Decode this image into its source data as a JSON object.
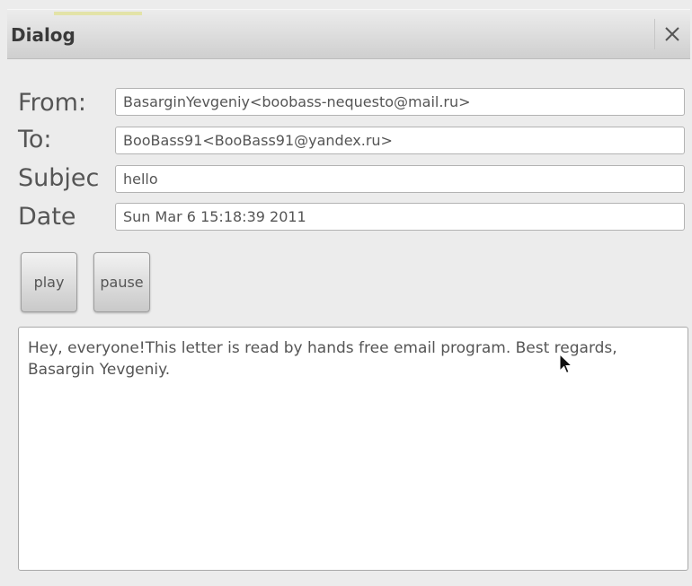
{
  "dialog": {
    "title": "Dialog",
    "close_icon": "close-icon"
  },
  "fields": {
    "from_label": "From:",
    "from_value": "BasarginYevgeniy<boobass-nequesto@mail.ru>",
    "to_label": "To:",
    "to_value": "BooBass91<BooBass91@yandex.ru>",
    "subject_label": "Subjec",
    "subject_value": "hello",
    "date_label": "Date",
    "date_value": "Sun Mar 6 15:18:39 2011"
  },
  "controls": {
    "play_label": "play",
    "pause_label": "pause"
  },
  "message": {
    "body": "Hey, everyone!This letter is read by hands free email program. Best regards, Basargin Yevgeniy."
  },
  "colors": {
    "background": "#ececec",
    "titlebar": "#d6d6d6",
    "text": "#555555"
  }
}
